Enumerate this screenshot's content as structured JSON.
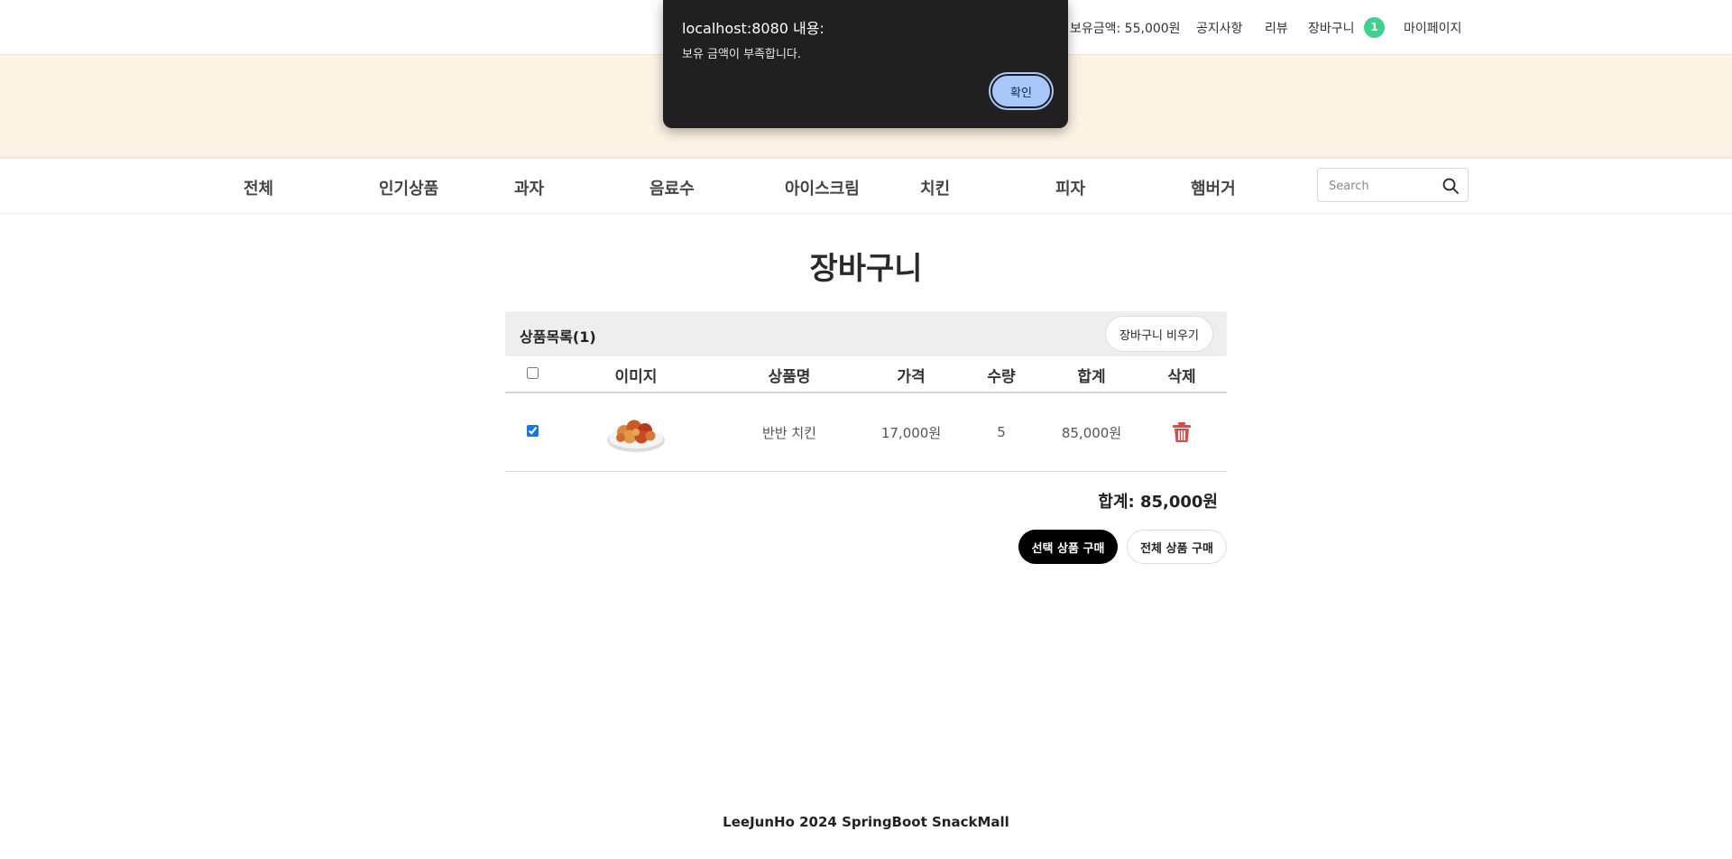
{
  "topbar": {
    "balance": "보유금액: 55,000원",
    "notice": "공지사항",
    "review": "리뷰",
    "cart": "장바구니",
    "cart_count": "1",
    "mypage": "마이페이지"
  },
  "categories": [
    "전체",
    "인기상품",
    "과자",
    "음료수",
    "아이스크림",
    "치킨",
    "피자",
    "햄버거"
  ],
  "search": {
    "placeholder": "Search"
  },
  "cart_page": {
    "title": "장바구니",
    "list_count": "상품목록(1)",
    "clear_button": "장바구니 비우기",
    "columns": {
      "image": "이미지",
      "name": "상품명",
      "price": "가격",
      "quantity": "수량",
      "total": "합계",
      "delete": "삭제"
    },
    "items": [
      {
        "checked": true,
        "image": "chicken-photo",
        "name": "반반 치킨",
        "price": "17,000원",
        "quantity": "5",
        "total": "85,000원"
      }
    ],
    "grand_total": "합계: 85,000원",
    "buy_selected": "선택 상품 구매",
    "buy_all": "전체 상품 구매"
  },
  "footer": "LeeJunHo 2024 SpringBoot SnackMall",
  "alert": {
    "title": "localhost:8080 내용:",
    "message": "보유 금액이 부족합니다.",
    "ok": "확인"
  },
  "colors": {
    "badge": "#3fd08f",
    "banner": "#fef4e6",
    "trash": "#e04848",
    "ok_button": "#a8c7fa"
  }
}
